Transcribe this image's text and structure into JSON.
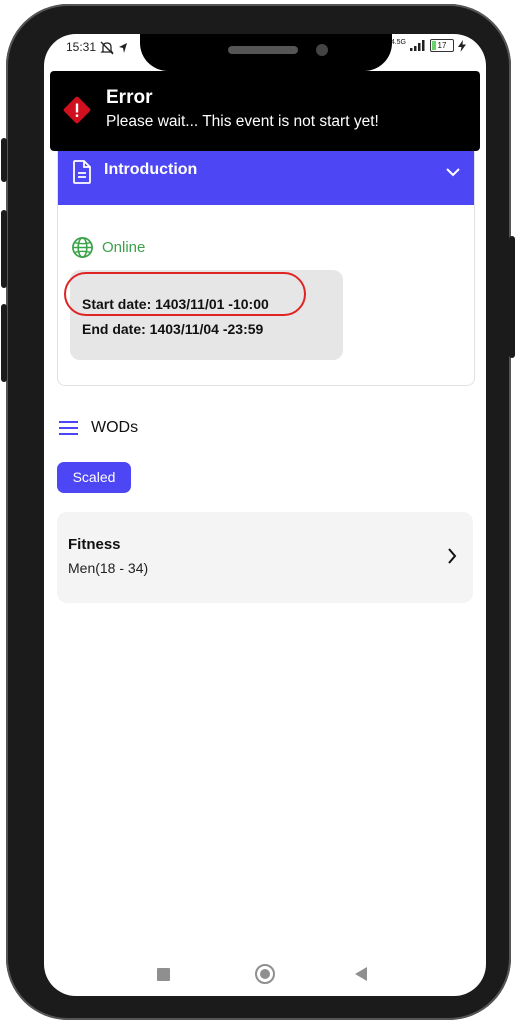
{
  "status_bar": {
    "time": "15:31",
    "network": "4.5G",
    "battery": "17"
  },
  "toast": {
    "title": "Error",
    "message": "Please wait... This event is not start yet!"
  },
  "introduction": {
    "title": "Introduction",
    "mode": "Online",
    "start_date": "Start date: 1403/11/01 -10:00",
    "end_date": "End date: 1403/11/04 -23:59"
  },
  "wods": {
    "label": "WODs",
    "tag": "Scaled",
    "item": {
      "title": "Fitness",
      "subtitle": "Men(18 - 34)"
    }
  },
  "colors": {
    "accent": "#4d46f5",
    "online": "#3aa34a",
    "error": "#e02424"
  }
}
